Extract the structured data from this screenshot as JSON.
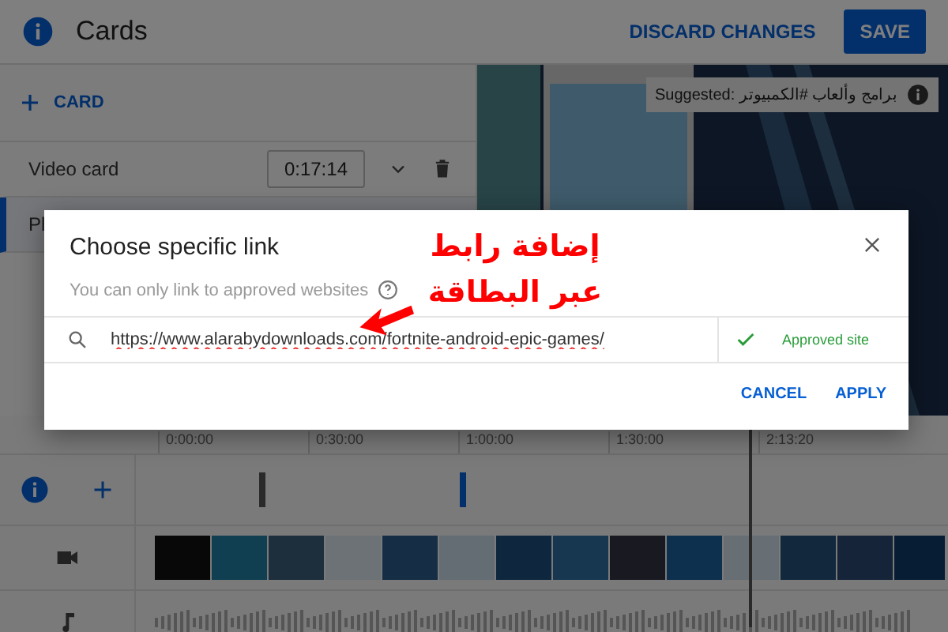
{
  "header": {
    "title": "Cards",
    "actions": [
      {
        "label": "DISCARD CHANGES",
        "kind": "text"
      },
      {
        "label": "SAVE",
        "kind": "filled"
      }
    ]
  },
  "add_card": {
    "label": "CARD"
  },
  "cards": [
    {
      "name": "Video card",
      "time": "0:17:14",
      "selected": false
    },
    {
      "name": "Pl",
      "selected": true
    }
  ],
  "preview": {
    "suggestion": "Suggested: برامج وألعاب #الكمبيوتر"
  },
  "timeline": {
    "ticks": [
      "0:00:00",
      "0:30:00",
      "1:00:00",
      "1:30:00",
      "2:13:20"
    ]
  },
  "dialog": {
    "title": "Choose specific link",
    "subtitle": "You can only link to approved websites",
    "url": {
      "value": "https://www.alarabydownloads.com/fortnite-android-epic-games/"
    },
    "status": "Approved site",
    "buttons": [
      "CANCEL",
      "APPLY"
    ]
  },
  "annotation": {
    "lines": [
      "إضافة رابط",
      "عبر البطاقة"
    ]
  }
}
